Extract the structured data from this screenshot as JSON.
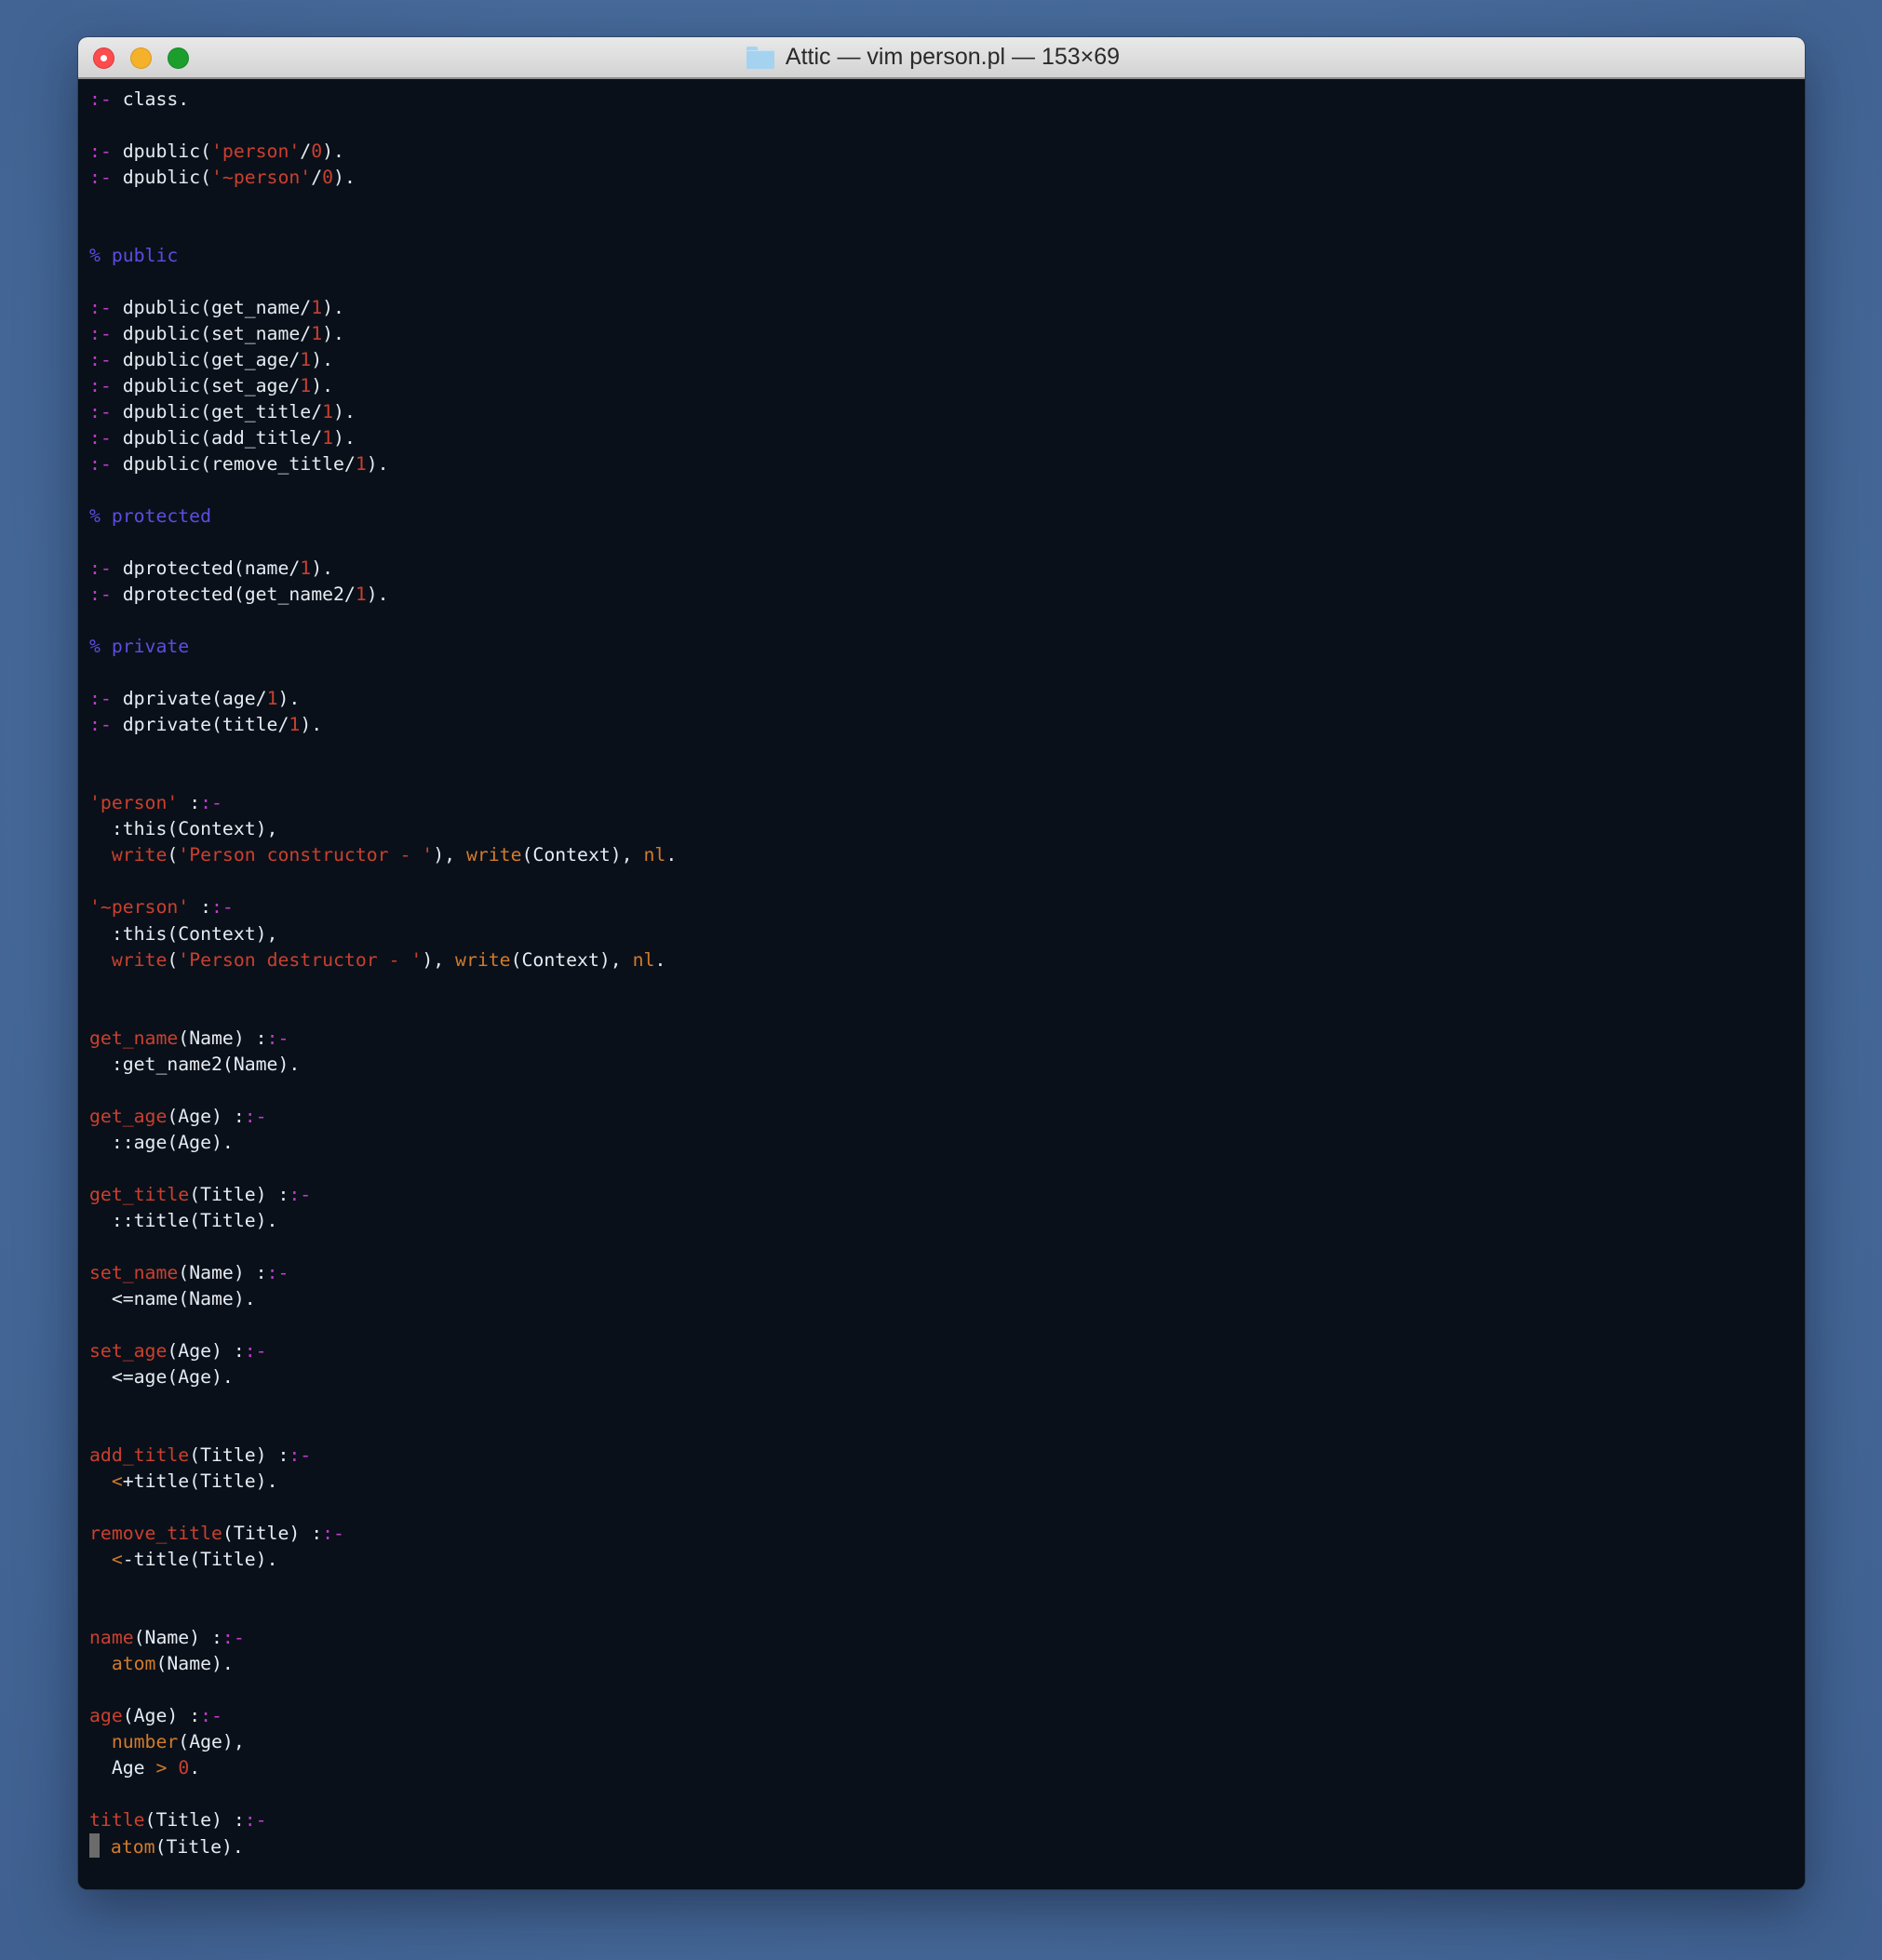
{
  "window": {
    "title": "Attic — vim person.pl — 153×69",
    "folder_icon": "folder-icon",
    "buttons": {
      "close": "close-button",
      "minimize": "minimize-button",
      "zoom": "zoom-button"
    }
  },
  "colors": {
    "background": "#0a1019",
    "default": "#e6ecf2",
    "keyword": "#c13bd1",
    "string": "#c9402f",
    "comment": "#5a4ee3",
    "builtin": "#d17b2c",
    "cursor": "#6b6b6b"
  },
  "editor": {
    "cursor": {
      "line": 67,
      "col": 0
    },
    "lines": [
      [
        [
          "kw",
          ":-"
        ],
        [
          "default",
          " class."
        ]
      ],
      [],
      [
        [
          "kw",
          ":-"
        ],
        [
          "default",
          " dpublic("
        ],
        [
          "str",
          "'person'"
        ],
        [
          "default",
          "/"
        ],
        [
          "num",
          "0"
        ],
        [
          "default",
          ")."
        ]
      ],
      [
        [
          "kw",
          ":-"
        ],
        [
          "default",
          " dpublic("
        ],
        [
          "str",
          "'~person'"
        ],
        [
          "default",
          "/"
        ],
        [
          "num",
          "0"
        ],
        [
          "default",
          ")."
        ]
      ],
      [],
      [],
      [
        [
          "comment",
          "% public"
        ]
      ],
      [],
      [
        [
          "kw",
          ":-"
        ],
        [
          "default",
          " dpublic(get_name/"
        ],
        [
          "num",
          "1"
        ],
        [
          "default",
          ")."
        ]
      ],
      [
        [
          "kw",
          ":-"
        ],
        [
          "default",
          " dpublic(set_name/"
        ],
        [
          "num",
          "1"
        ],
        [
          "default",
          ")."
        ]
      ],
      [
        [
          "kw",
          ":-"
        ],
        [
          "default",
          " dpublic(get_age/"
        ],
        [
          "num",
          "1"
        ],
        [
          "default",
          ")."
        ]
      ],
      [
        [
          "kw",
          ":-"
        ],
        [
          "default",
          " dpublic(set_age/"
        ],
        [
          "num",
          "1"
        ],
        [
          "default",
          ")."
        ]
      ],
      [
        [
          "kw",
          ":-"
        ],
        [
          "default",
          " dpublic(get_title/"
        ],
        [
          "num",
          "1"
        ],
        [
          "default",
          ")."
        ]
      ],
      [
        [
          "kw",
          ":-"
        ],
        [
          "default",
          " dpublic(add_title/"
        ],
        [
          "num",
          "1"
        ],
        [
          "default",
          ")."
        ]
      ],
      [
        [
          "kw",
          ":-"
        ],
        [
          "default",
          " dpublic(remove_title/"
        ],
        [
          "num",
          "1"
        ],
        [
          "default",
          ")."
        ]
      ],
      [],
      [
        [
          "comment",
          "% protected"
        ]
      ],
      [],
      [
        [
          "kw",
          ":-"
        ],
        [
          "default",
          " dprotected(name/"
        ],
        [
          "num",
          "1"
        ],
        [
          "default",
          ")."
        ]
      ],
      [
        [
          "kw",
          ":-"
        ],
        [
          "default",
          " dprotected(get_name2/"
        ],
        [
          "num",
          "1"
        ],
        [
          "default",
          ")."
        ]
      ],
      [],
      [
        [
          "comment",
          "% private"
        ]
      ],
      [],
      [
        [
          "kw",
          ":-"
        ],
        [
          "default",
          " dprivate(age/"
        ],
        [
          "num",
          "1"
        ],
        [
          "default",
          ")."
        ]
      ],
      [
        [
          "kw",
          ":-"
        ],
        [
          "default",
          " dprivate(title/"
        ],
        [
          "num",
          "1"
        ],
        [
          "default",
          ")."
        ]
      ],
      [],
      [],
      [
        [
          "str",
          "'person'"
        ],
        [
          "default",
          " :"
        ],
        [
          "kw",
          ":-"
        ]
      ],
      [
        [
          "default",
          "  :this(Context),"
        ]
      ],
      [
        [
          "default",
          "  "
        ],
        [
          "fn",
          "write"
        ],
        [
          "default",
          "("
        ],
        [
          "str",
          "'Person constructor - '"
        ],
        [
          "default",
          "), "
        ],
        [
          "builtin",
          "write"
        ],
        [
          "default",
          "(Context), "
        ],
        [
          "builtin",
          "nl"
        ],
        [
          "default",
          "."
        ]
      ],
      [],
      [
        [
          "str",
          "'~person'"
        ],
        [
          "default",
          " :"
        ],
        [
          "kw",
          ":-"
        ]
      ],
      [
        [
          "default",
          "  :this(Context),"
        ]
      ],
      [
        [
          "default",
          "  "
        ],
        [
          "fn",
          "write"
        ],
        [
          "default",
          "("
        ],
        [
          "str",
          "'Person destructor - '"
        ],
        [
          "default",
          "), "
        ],
        [
          "builtin",
          "write"
        ],
        [
          "default",
          "(Context), "
        ],
        [
          "builtin",
          "nl"
        ],
        [
          "default",
          "."
        ]
      ],
      [],
      [],
      [
        [
          "fn",
          "get_name"
        ],
        [
          "default",
          "(Name) :"
        ],
        [
          "kw",
          ":-"
        ]
      ],
      [
        [
          "default",
          "  :get_name2(Name)."
        ]
      ],
      [],
      [
        [
          "fn",
          "get_age"
        ],
        [
          "default",
          "(Age) :"
        ],
        [
          "kw",
          ":-"
        ]
      ],
      [
        [
          "default",
          "  ::age(Age)."
        ]
      ],
      [],
      [
        [
          "fn",
          "get_title"
        ],
        [
          "default",
          "(Title) :"
        ],
        [
          "kw",
          ":-"
        ]
      ],
      [
        [
          "default",
          "  ::title(Title)."
        ]
      ],
      [],
      [
        [
          "fn",
          "set_name"
        ],
        [
          "default",
          "(Name) :"
        ],
        [
          "kw",
          ":-"
        ]
      ],
      [
        [
          "default",
          "  <=name(Name)."
        ]
      ],
      [],
      [
        [
          "fn",
          "set_age"
        ],
        [
          "default",
          "(Age) :"
        ],
        [
          "kw",
          ":-"
        ]
      ],
      [
        [
          "default",
          "  <=age(Age)."
        ]
      ],
      [],
      [],
      [
        [
          "fn",
          "add_title"
        ],
        [
          "default",
          "(Title) :"
        ],
        [
          "kw",
          ":-"
        ]
      ],
      [
        [
          "default",
          "  "
        ],
        [
          "op",
          "<"
        ],
        [
          "default",
          "+title(Title)."
        ]
      ],
      [],
      [
        [
          "fn",
          "remove_title"
        ],
        [
          "default",
          "(Title) :"
        ],
        [
          "kw",
          ":-"
        ]
      ],
      [
        [
          "default",
          "  "
        ],
        [
          "op",
          "<"
        ],
        [
          "default",
          "-title(Title)."
        ]
      ],
      [],
      [],
      [
        [
          "fn",
          "name"
        ],
        [
          "default",
          "(Name) :"
        ],
        [
          "kw",
          ":-"
        ]
      ],
      [
        [
          "default",
          "  "
        ],
        [
          "builtin",
          "atom"
        ],
        [
          "default",
          "(Name)."
        ]
      ],
      [],
      [
        [
          "fn",
          "age"
        ],
        [
          "default",
          "(Age) :"
        ],
        [
          "kw",
          ":-"
        ]
      ],
      [
        [
          "default",
          "  "
        ],
        [
          "builtin",
          "number"
        ],
        [
          "default",
          "(Age),"
        ]
      ],
      [
        [
          "default",
          "  Age "
        ],
        [
          "op",
          ">"
        ],
        [
          "default",
          " "
        ],
        [
          "num",
          "0"
        ],
        [
          "default",
          "."
        ]
      ],
      [],
      [
        [
          "fn",
          "title"
        ],
        [
          "default",
          "(Title) :"
        ],
        [
          "kw",
          ":-"
        ]
      ],
      [
        [
          "default",
          " "
        ],
        [
          "builtin",
          "atom"
        ],
        [
          "default",
          "(Title)."
        ]
      ]
    ]
  }
}
